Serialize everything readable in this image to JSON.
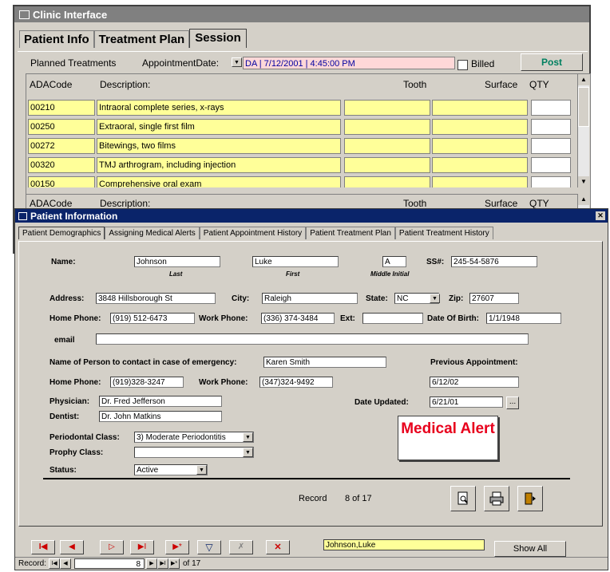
{
  "clinic": {
    "title": "Clinic Interface",
    "tabs": [
      "Patient Info",
      "Treatment Plan",
      "Session"
    ],
    "planned_treatments_label": "Planned Treatments",
    "appointment_date_label": "AppointmentDate:",
    "appointment_date_value": "DA | 7/12/2001 | 4:45:00 PM",
    "billed_label": "Billed",
    "post_label": "Post",
    "columns": {
      "code": "ADACode",
      "desc": "Description:",
      "tooth": "Tooth",
      "surface": "Surface",
      "qty": "QTY"
    },
    "rows": [
      {
        "code": "00210",
        "desc": "Intraoral complete series, x-rays"
      },
      {
        "code": "00250",
        "desc": "Extraoral, single first film"
      },
      {
        "code": "00272",
        "desc": "Bitewings, two films"
      },
      {
        "code": "00320",
        "desc": "TMJ arthrogram, including injection"
      },
      {
        "code": "00150",
        "desc": "Comprehensive oral exam"
      }
    ]
  },
  "patient": {
    "title": "Patient Information",
    "tabs": [
      "Patient Demographics",
      "Assigning Medical Alerts",
      "Patient Appointment History",
      "Patient Treatment Plan",
      "Patient Treatment History"
    ],
    "labels": {
      "name": "Name:",
      "last": "Last",
      "first": "First",
      "middle": "Middle Initial",
      "ssn": "SS#:",
      "address": "Address:",
      "city": "City:",
      "state": "State:",
      "zip": "Zip:",
      "home_phone": "Home Phone:",
      "work_phone": "Work Phone:",
      "ext": "Ext:",
      "dob": "Date Of Birth:",
      "email": "email",
      "emergency": "Name of Person to contact in case of emergency:",
      "prev_appt": "Previous Appointment:",
      "physician": "Physician:",
      "dentist": "Dentist:",
      "date_updated": "Date Updated:",
      "perio": "Periodontal Class:",
      "prophy": "Prophy Class:",
      "status": "Status:"
    },
    "values": {
      "last": "Johnson",
      "first": "Luke",
      "middle": "A",
      "ssn": "245-54-5876",
      "address": "3848 Hillsborough St",
      "city": "Raleigh",
      "state": "NC",
      "zip": "27607",
      "home_phone": "(919) 512-6473",
      "work_phone": "(336) 374-3484",
      "ext": "",
      "dob": "1/1/1948",
      "email": "",
      "emergency_name": "Karen Smith",
      "prev_appt": "6/12/02",
      "em_home_phone": "(919)328-3247",
      "em_work_phone": "(347)324-9492",
      "physician": "Dr. Fred Jefferson",
      "dentist": "Dr. John Matkins",
      "date_updated": "6/21/01",
      "perio": "3) Moderate Periodontitis",
      "prophy": "",
      "status": "Active"
    },
    "medical_alert": "Medical Alert",
    "record_label": "Record",
    "record_value": "8 of 17",
    "search_value": "Johnson,Luke",
    "show_all": "Show All",
    "nav_record_label": "Record:",
    "nav_record_number": "8",
    "nav_of": "of 17",
    "ellipsis": "..."
  },
  "colors": {
    "title_blue": "#0a246a",
    "alert_red": "#e8001c",
    "field_yellow": "#ffff99",
    "nav_red": "#cc0000"
  }
}
